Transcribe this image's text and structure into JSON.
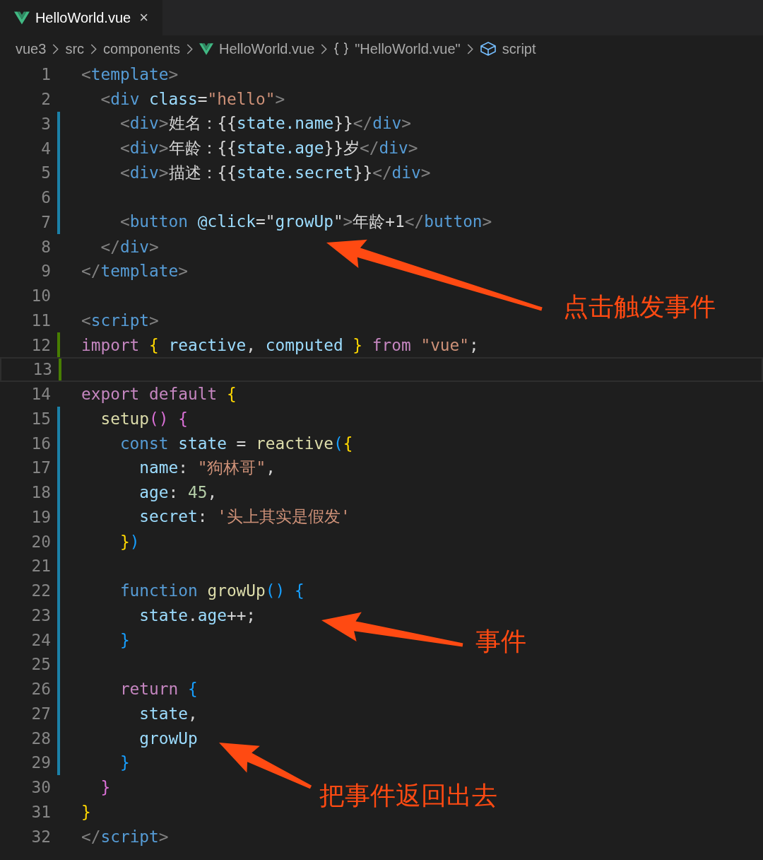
{
  "tabs": [
    {
      "label": "HelloWorld.vue",
      "close": "×",
      "selected": true
    }
  ],
  "breadcrumb": [
    {
      "kind": "folder",
      "label": "vue3"
    },
    {
      "kind": "folder",
      "label": "src"
    },
    {
      "kind": "folder",
      "label": "components"
    },
    {
      "kind": "file",
      "label": "HelloWorld.vue"
    },
    {
      "kind": "object",
      "label": "\"HelloWorld.vue\""
    },
    {
      "kind": "module",
      "label": "script"
    }
  ],
  "lines": [
    {
      "number": "1",
      "modified": false,
      "added": false,
      "current": false,
      "tokens": [
        {
          "text": "<",
          "kind": "p"
        },
        {
          "text": "template",
          "kind": "tag"
        },
        {
          "text": ">",
          "kind": "p"
        }
      ]
    },
    {
      "number": "2",
      "modified": false,
      "added": false,
      "current": false,
      "tokens": [
        {
          "text": "  <",
          "kind": "p"
        },
        {
          "text": "div",
          "kind": "tag"
        },
        {
          "text": " class",
          "kind": "attr"
        },
        {
          "text": "=",
          "kind": "txt"
        },
        {
          "text": "\"hello\"",
          "kind": "str"
        },
        {
          "text": ">",
          "kind": "p"
        }
      ]
    },
    {
      "number": "3",
      "modified": true,
      "added": false,
      "current": false,
      "tokens": [
        {
          "text": "    <",
          "kind": "p"
        },
        {
          "text": "div",
          "kind": "tag"
        },
        {
          "text": ">",
          "kind": "p"
        },
        {
          "text": "姓名：{{",
          "kind": "txt"
        },
        {
          "text": "state.name",
          "kind": "var"
        },
        {
          "text": "}}",
          "kind": "txt"
        },
        {
          "text": "</",
          "kind": "p"
        },
        {
          "text": "div",
          "kind": "tag"
        },
        {
          "text": ">",
          "kind": "p"
        }
      ]
    },
    {
      "number": "4",
      "modified": true,
      "added": false,
      "current": false,
      "tokens": [
        {
          "text": "    <",
          "kind": "p"
        },
        {
          "text": "div",
          "kind": "tag"
        },
        {
          "text": ">",
          "kind": "p"
        },
        {
          "text": "年龄：{{",
          "kind": "txt"
        },
        {
          "text": "state.age",
          "kind": "var"
        },
        {
          "text": "}}岁",
          "kind": "txt"
        },
        {
          "text": "</",
          "kind": "p"
        },
        {
          "text": "div",
          "kind": "tag"
        },
        {
          "text": ">",
          "kind": "p"
        }
      ]
    },
    {
      "number": "5",
      "modified": true,
      "added": false,
      "current": false,
      "tokens": [
        {
          "text": "    <",
          "kind": "p"
        },
        {
          "text": "div",
          "kind": "tag"
        },
        {
          "text": ">",
          "kind": "p"
        },
        {
          "text": "描述：{{",
          "kind": "txt"
        },
        {
          "text": "state.secret",
          "kind": "var"
        },
        {
          "text": "}}",
          "kind": "txt"
        },
        {
          "text": "</",
          "kind": "p"
        },
        {
          "text": "div",
          "kind": "tag"
        },
        {
          "text": ">",
          "kind": "p"
        }
      ]
    },
    {
      "number": "6",
      "modified": true,
      "added": false,
      "current": false
    },
    {
      "number": "7",
      "modified": true,
      "added": false,
      "current": false,
      "tokens": [
        {
          "text": "    <",
          "kind": "p"
        },
        {
          "text": "button",
          "kind": "tag"
        },
        {
          "text": " @click",
          "kind": "attr"
        },
        {
          "text": "=\"",
          "kind": "txt"
        },
        {
          "text": "growUp",
          "kind": "var"
        },
        {
          "text": "\"",
          "kind": "txt"
        },
        {
          "text": ">",
          "kind": "p"
        },
        {
          "text": "年龄+1",
          "kind": "txt"
        },
        {
          "text": "</",
          "kind": "p"
        },
        {
          "text": "button",
          "kind": "tag"
        },
        {
          "text": ">",
          "kind": "p"
        }
      ]
    },
    {
      "number": "8",
      "modified": false,
      "added": false,
      "current": false,
      "tokens": [
        {
          "text": "  </",
          "kind": "p"
        },
        {
          "text": "div",
          "kind": "tag"
        },
        {
          "text": ">",
          "kind": "p"
        }
      ]
    },
    {
      "number": "9",
      "modified": false,
      "added": false,
      "current": false,
      "tokens": [
        {
          "text": "</",
          "kind": "p"
        },
        {
          "text": "template",
          "kind": "tag"
        },
        {
          "text": ">",
          "kind": "p"
        }
      ]
    },
    {
      "number": "10",
      "modified": false,
      "added": false,
      "current": false
    },
    {
      "number": "11",
      "modified": false,
      "added": false,
      "current": false,
      "tokens": [
        {
          "text": "<",
          "kind": "p"
        },
        {
          "text": "script",
          "kind": "tag"
        },
        {
          "text": ">",
          "kind": "p"
        }
      ]
    },
    {
      "number": "12",
      "modified": false,
      "added": true,
      "current": false,
      "tokens": [
        {
          "text": "import",
          "kind": "kw"
        },
        {
          "text": " {",
          "kind": "b1"
        },
        {
          "text": " reactive",
          "kind": "var"
        },
        {
          "text": ",",
          "kind": "txt"
        },
        {
          "text": " computed",
          "kind": "var"
        },
        {
          "text": " }",
          "kind": "b1"
        },
        {
          "text": " from",
          "kind": "kw"
        },
        {
          "text": " \"vue\"",
          "kind": "str"
        },
        {
          "text": ";",
          "kind": "txt"
        }
      ]
    },
    {
      "number": "13",
      "modified": false,
      "added": true,
      "current": true
    },
    {
      "number": "14",
      "modified": false,
      "added": false,
      "current": false,
      "tokens": [
        {
          "text": "export default",
          "kind": "kw"
        },
        {
          "text": " {",
          "kind": "b1"
        }
      ]
    },
    {
      "number": "15",
      "modified": true,
      "added": false,
      "current": false,
      "tokens": [
        {
          "text": "  setup",
          "kind": "fn"
        },
        {
          "text": "()",
          "kind": "b2"
        },
        {
          "text": " {",
          "kind": "b2"
        }
      ]
    },
    {
      "number": "16",
      "modified": true,
      "added": false,
      "current": false,
      "tokens": [
        {
          "text": "    const",
          "kind": "st"
        },
        {
          "text": " state",
          "kind": "var"
        },
        {
          "text": " = ",
          "kind": "txt"
        },
        {
          "text": "reactive",
          "kind": "fn"
        },
        {
          "text": "(",
          "kind": "b3"
        },
        {
          "text": "{",
          "kind": "b1"
        }
      ]
    },
    {
      "number": "17",
      "modified": true,
      "added": false,
      "current": false,
      "tokens": [
        {
          "text": "      name",
          "kind": "var"
        },
        {
          "text": ": ",
          "kind": "txt"
        },
        {
          "text": "\"狗林哥\"",
          "kind": "str"
        },
        {
          "text": ",",
          "kind": "txt"
        }
      ]
    },
    {
      "number": "18",
      "modified": true,
      "added": false,
      "current": false,
      "tokens": [
        {
          "text": "      age",
          "kind": "var"
        },
        {
          "text": ": ",
          "kind": "txt"
        },
        {
          "text": "45",
          "kind": "num"
        },
        {
          "text": ",",
          "kind": "txt"
        }
      ]
    },
    {
      "number": "19",
      "modified": true,
      "added": false,
      "current": false,
      "tokens": [
        {
          "text": "      secret",
          "kind": "var"
        },
        {
          "text": ": ",
          "kind": "txt"
        },
        {
          "text": "'头上其实是假发'",
          "kind": "str"
        }
      ]
    },
    {
      "number": "20",
      "modified": true,
      "added": false,
      "current": false,
      "tokens": [
        {
          "text": "    }",
          "kind": "b1"
        },
        {
          "text": ")",
          "kind": "b3"
        }
      ]
    },
    {
      "number": "21",
      "modified": true,
      "added": false,
      "current": false
    },
    {
      "number": "22",
      "modified": true,
      "added": false,
      "current": false,
      "tokens": [
        {
          "text": "    function",
          "kind": "st"
        },
        {
          "text": " growUp",
          "kind": "fn"
        },
        {
          "text": "()",
          "kind": "b3"
        },
        {
          "text": " {",
          "kind": "b3"
        }
      ]
    },
    {
      "number": "23",
      "modified": true,
      "added": false,
      "current": false,
      "tokens": [
        {
          "text": "      state",
          "kind": "var"
        },
        {
          "text": ".",
          "kind": "txt"
        },
        {
          "text": "age",
          "kind": "var"
        },
        {
          "text": "++;",
          "kind": "txt"
        }
      ]
    },
    {
      "number": "24",
      "modified": true,
      "added": false,
      "current": false,
      "tokens": [
        {
          "text": "    }",
          "kind": "b3"
        }
      ]
    },
    {
      "number": "25",
      "modified": true,
      "added": false,
      "current": false
    },
    {
      "number": "26",
      "modified": true,
      "added": false,
      "current": false,
      "tokens": [
        {
          "text": "    return",
          "kind": "kw"
        },
        {
          "text": " {",
          "kind": "b3"
        }
      ]
    },
    {
      "number": "27",
      "modified": true,
      "added": false,
      "current": false,
      "tokens": [
        {
          "text": "      state",
          "kind": "var"
        },
        {
          "text": ",",
          "kind": "txt"
        }
      ]
    },
    {
      "number": "28",
      "modified": true,
      "added": false,
      "current": false,
      "tokens": [
        {
          "text": "      growUp",
          "kind": "var"
        }
      ]
    },
    {
      "number": "29",
      "modified": true,
      "added": false,
      "current": false,
      "tokens": [
        {
          "text": "    }",
          "kind": "b3"
        }
      ]
    },
    {
      "number": "30",
      "modified": false,
      "added": false,
      "current": false,
      "tokens": [
        {
          "text": "  }",
          "kind": "b2"
        }
      ]
    },
    {
      "number": "31",
      "modified": false,
      "added": false,
      "current": false,
      "tokens": [
        {
          "text": "}",
          "kind": "b1"
        }
      ]
    },
    {
      "number": "32",
      "modified": false,
      "added": false,
      "current": false,
      "tokens": [
        {
          "text": "</",
          "kind": "p"
        },
        {
          "text": "script",
          "kind": "tag"
        },
        {
          "text": ">",
          "kind": "p"
        }
      ]
    }
  ],
  "annotations": [
    {
      "text": "点击触发事件"
    },
    {
      "text": "事件"
    },
    {
      "text": "把事件返回出去"
    }
  ]
}
